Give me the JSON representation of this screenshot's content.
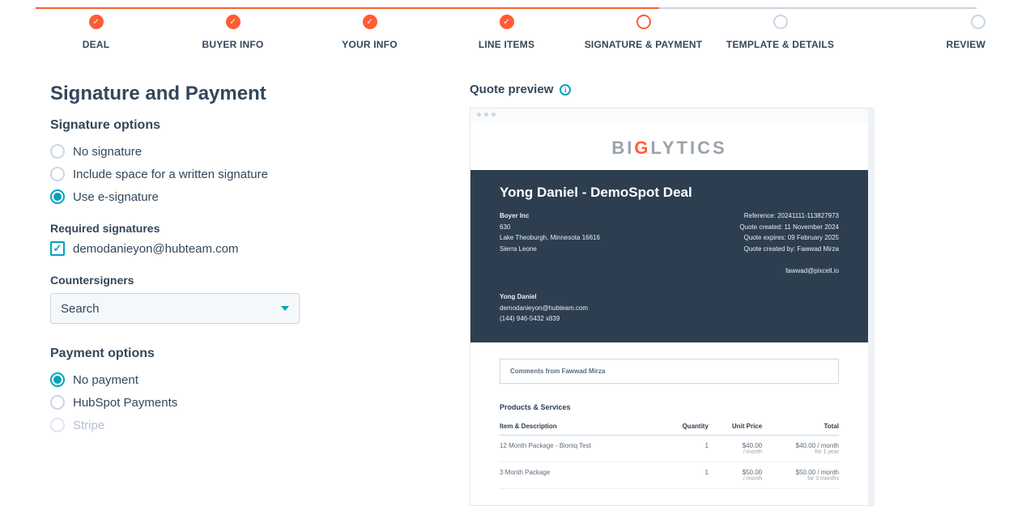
{
  "stepper": {
    "steps": [
      {
        "label": "DEAL",
        "state": "done"
      },
      {
        "label": "BUYER INFO",
        "state": "done"
      },
      {
        "label": "YOUR INFO",
        "state": "done"
      },
      {
        "label": "LINE ITEMS",
        "state": "done"
      },
      {
        "label": "SIGNATURE & PAYMENT",
        "state": "current"
      },
      {
        "label": "TEMPLATE & DETAILS",
        "state": "future"
      },
      {
        "label": "REVIEW",
        "state": "future"
      }
    ]
  },
  "page": {
    "title": "Signature and Payment"
  },
  "signature": {
    "section_title": "Signature options",
    "options": {
      "none": "No signature",
      "written": "Include space for a written signature",
      "esig": "Use e-signature"
    },
    "selected": "esig",
    "required_title": "Required signatures",
    "required_email": "demodanieyon@hubteam.com",
    "counter_title": "Countersigners",
    "counter_placeholder": "Search"
  },
  "payment": {
    "section_title": "Payment options",
    "options": {
      "none": "No payment",
      "hubspot": "HubSpot Payments",
      "stripe": "Stripe"
    },
    "selected": "none",
    "disabled": [
      "stripe"
    ]
  },
  "preview": {
    "header": "Quote preview",
    "logo_pre": "BI",
    "logo_g": "G",
    "logo_post": "LYTICS",
    "deal_title": "Yong Daniel - DemoSpot Deal",
    "buyer": {
      "company": "Boyer Inc",
      "line2": "630",
      "line3": "Lake Theoburgh, Minnesota 16616",
      "line4": "Sierra Leone"
    },
    "meta": {
      "ref": "Reference: 20241111-113827973",
      "created": "Quote created: 11 November 2024",
      "expires": "Quote expires: 09 February 2025",
      "by": "Quote created by: Fawwad Mirza",
      "email": "fawwad@pixcell.io"
    },
    "contact": {
      "name": "Yong Daniel",
      "email": "demodanieyon@hubteam.com",
      "phone": "(144) 946-5432 x839"
    },
    "comments_label": "Comments from Fawwad Mirza",
    "products_header": "Products & Services",
    "table": {
      "cols": {
        "item": "Item & Description",
        "qty": "Quantity",
        "unit": "Unit Price",
        "total": "Total"
      },
      "rows": [
        {
          "name": "12 Month Package - Bioniq Test",
          "qty": "1",
          "unit": "$40.00",
          "unit_sub": "/ month",
          "total": "$40.00 / month",
          "total_sub": "for 1 year"
        },
        {
          "name": "3 Month Package",
          "qty": "1",
          "unit": "$50.00",
          "unit_sub": "/ month",
          "total": "$50.00 / month",
          "total_sub": "for 3 months"
        }
      ]
    }
  }
}
